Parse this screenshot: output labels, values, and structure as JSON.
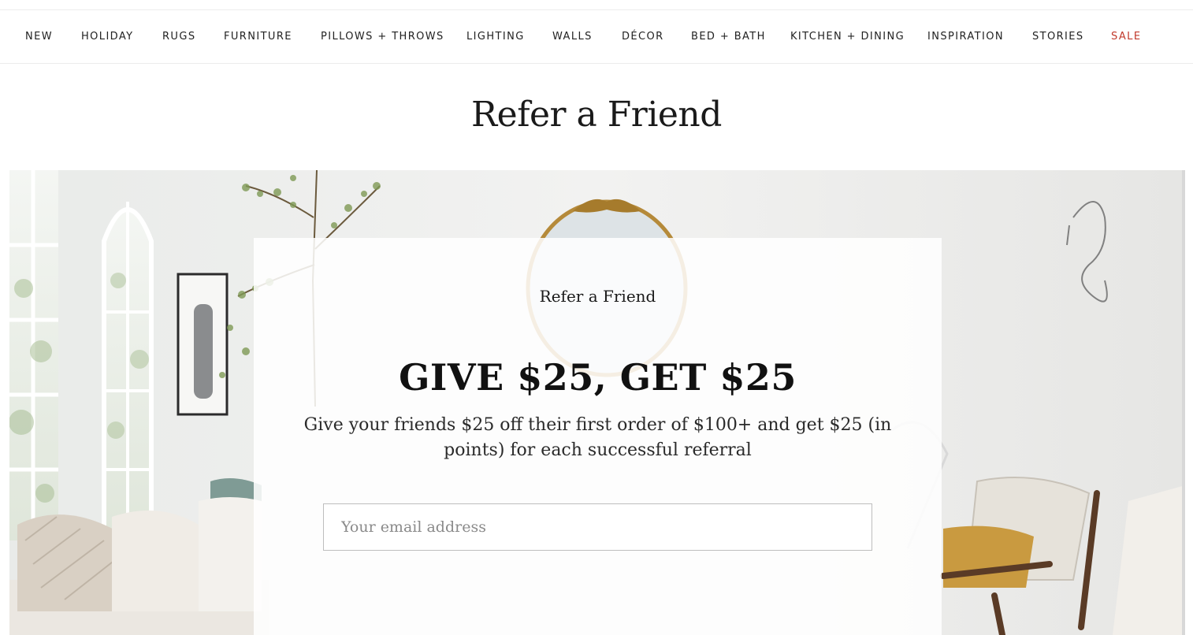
{
  "nav": {
    "items": [
      {
        "label": "NEW"
      },
      {
        "label": "HOLIDAY"
      },
      {
        "label": "RUGS"
      },
      {
        "label": "FURNITURE"
      },
      {
        "label": "PILLOWS + THROWS"
      },
      {
        "label": "LIGHTING"
      },
      {
        "label": "WALLS"
      },
      {
        "label": "DÉCOR"
      },
      {
        "label": "BED + BATH"
      },
      {
        "label": "KITCHEN + DINING"
      },
      {
        "label": "INSPIRATION"
      },
      {
        "label": "STORIES"
      },
      {
        "label": "SALE"
      }
    ],
    "sale_color": "#c0392b"
  },
  "page": {
    "title": "Refer a Friend"
  },
  "referral_card": {
    "eyebrow": "Refer a Friend",
    "headline": "GIVE $25, GET $25",
    "body": "Give your friends $25 off their first order of $100+ and get $25 (in points) for each successful referral",
    "email_placeholder": "Your email address"
  }
}
